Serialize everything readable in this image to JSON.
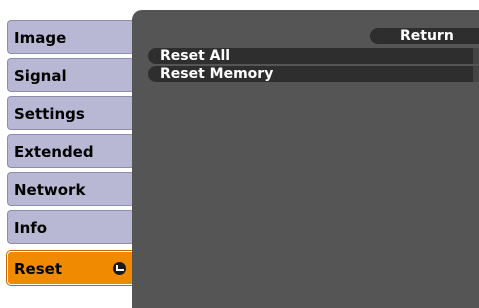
{
  "menu": {
    "items": [
      {
        "label": "Image"
      },
      {
        "label": "Signal"
      },
      {
        "label": "Settings"
      },
      {
        "label": "Extended"
      },
      {
        "label": "Network"
      },
      {
        "label": "Info"
      },
      {
        "label": "Reset",
        "selected": true,
        "icon": "enter-icon"
      }
    ]
  },
  "panel": {
    "return_label": "Return",
    "options": [
      {
        "label": "Reset All"
      },
      {
        "label": "Reset Memory"
      }
    ]
  },
  "colors": {
    "menu_item_bg": "#b8b8d4",
    "selected_bg": "#f08a00",
    "panel_bg": "#555555",
    "option_bg": "#2e2e2e",
    "text_light": "#ffffff"
  }
}
